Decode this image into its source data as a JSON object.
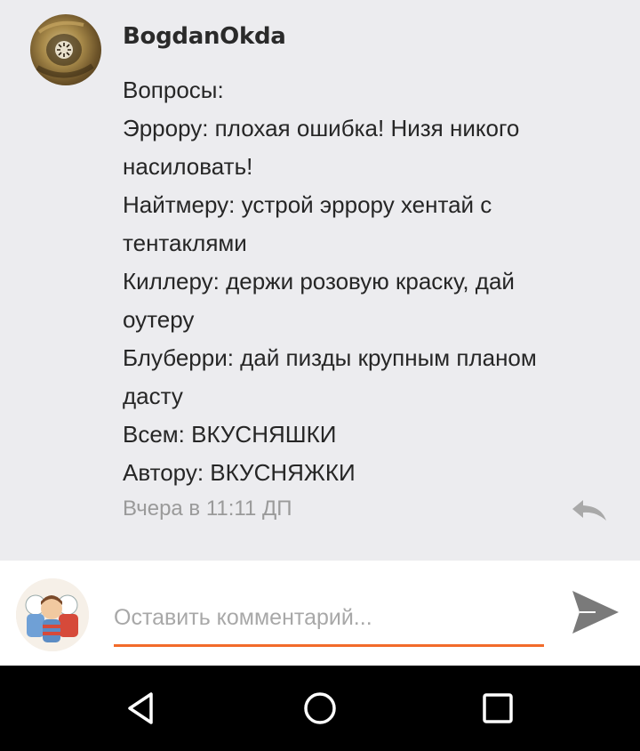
{
  "comment": {
    "author": "BogdanOkda",
    "lines": [
      "Вопросы:",
      "Эррору: плохая ошибка! Низя никого",
      "насиловать!",
      "Найтмеру: устрой эррору хентай с",
      "тентаклями",
      "Киллеру: держи розовую краску, дай",
      "оутеру",
      "Блуберри: дай пизды крупным планом",
      "дасту",
      "Всем: ВКУСНЯШКИ",
      "Автору: ВКУСНЯЖКИ"
    ],
    "timestamp": "Вчера в 11:11 ДП",
    "reply_icon": "reply-arrow-icon"
  },
  "input": {
    "placeholder": "Оставить комментарий...",
    "value": "",
    "send_icon": "send-icon",
    "accent_color": "#f26b2a"
  },
  "nav": {
    "back_icon": "back-triangle-icon",
    "home_icon": "home-circle-icon",
    "recent_icon": "recent-square-icon"
  }
}
